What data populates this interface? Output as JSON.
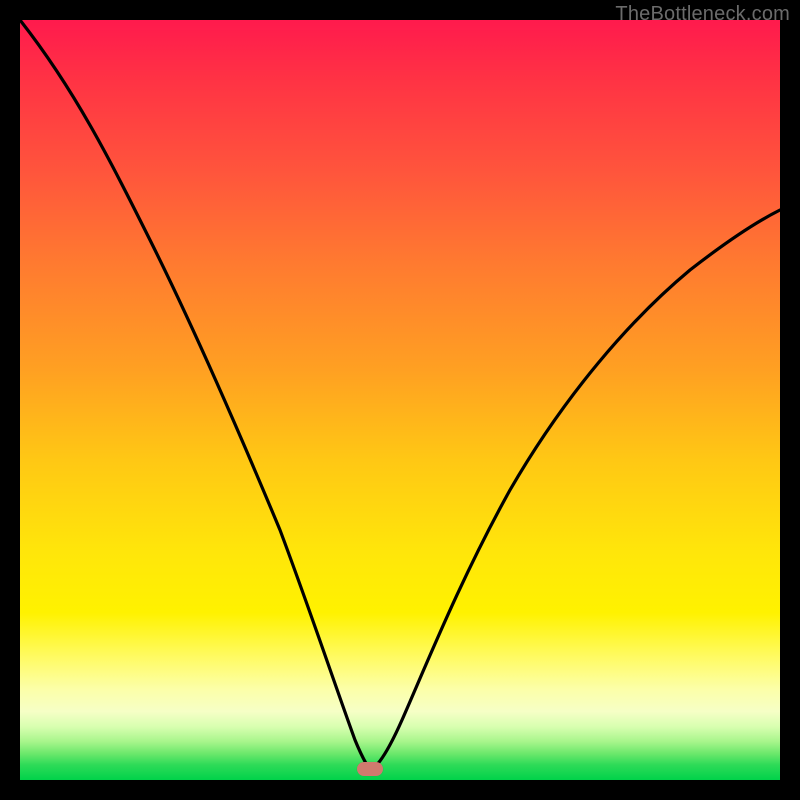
{
  "watermark": "TheBottleneck.com",
  "marker": {
    "x_pct": 46,
    "y_pct": 98.5
  },
  "colors": {
    "frame": "#000000",
    "gradient_top": "#ff1a4d",
    "gradient_mid": "#ffe60a",
    "gradient_bottom": "#00d24a",
    "curve": "#000000",
    "marker": "#d07a6e",
    "watermark": "#6b6b6b"
  },
  "chart_data": {
    "type": "line",
    "title": "",
    "xlabel": "",
    "ylabel": "",
    "xlim": [
      0,
      100
    ],
    "ylim": [
      0,
      100
    ],
    "grid": false,
    "legend": false,
    "annotations": [
      "TheBottleneck.com"
    ],
    "series": [
      {
        "name": "bottleneck-curve",
        "x": [
          0,
          5,
          10,
          15,
          20,
          25,
          30,
          35,
          40,
          43,
          46,
          49,
          52,
          57,
          63,
          70,
          78,
          86,
          93,
          100
        ],
        "y": [
          100,
          94,
          88,
          81,
          74,
          65,
          54,
          41,
          25,
          12,
          2,
          7,
          15,
          27,
          40,
          51,
          60,
          67,
          72,
          75
        ]
      }
    ],
    "minimum_point": {
      "x": 46,
      "y": 1.5
    }
  }
}
